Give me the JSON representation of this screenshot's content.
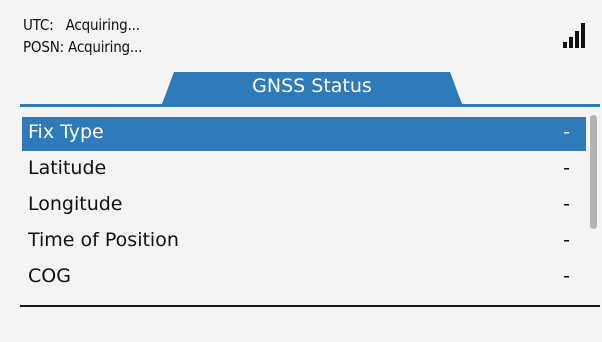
{
  "header": {
    "utc_line": "UTC:   Acquiring...",
    "posn_line": "POSN: Acquiring...",
    "signal_icon": "signal-strength-icon"
  },
  "tab": {
    "title": "GNSS Status"
  },
  "list": {
    "rows": [
      {
        "label": "Fix Type",
        "value": "-",
        "selected": true
      },
      {
        "label": "Latitude",
        "value": "-"
      },
      {
        "label": "Longitude",
        "value": "-"
      },
      {
        "label": "Time of Position",
        "value": "-"
      },
      {
        "label": "COG",
        "value": "-"
      }
    ]
  },
  "colors": {
    "accent": "#2f7ab9",
    "background": "#f4f4f4",
    "text": "#111111"
  }
}
